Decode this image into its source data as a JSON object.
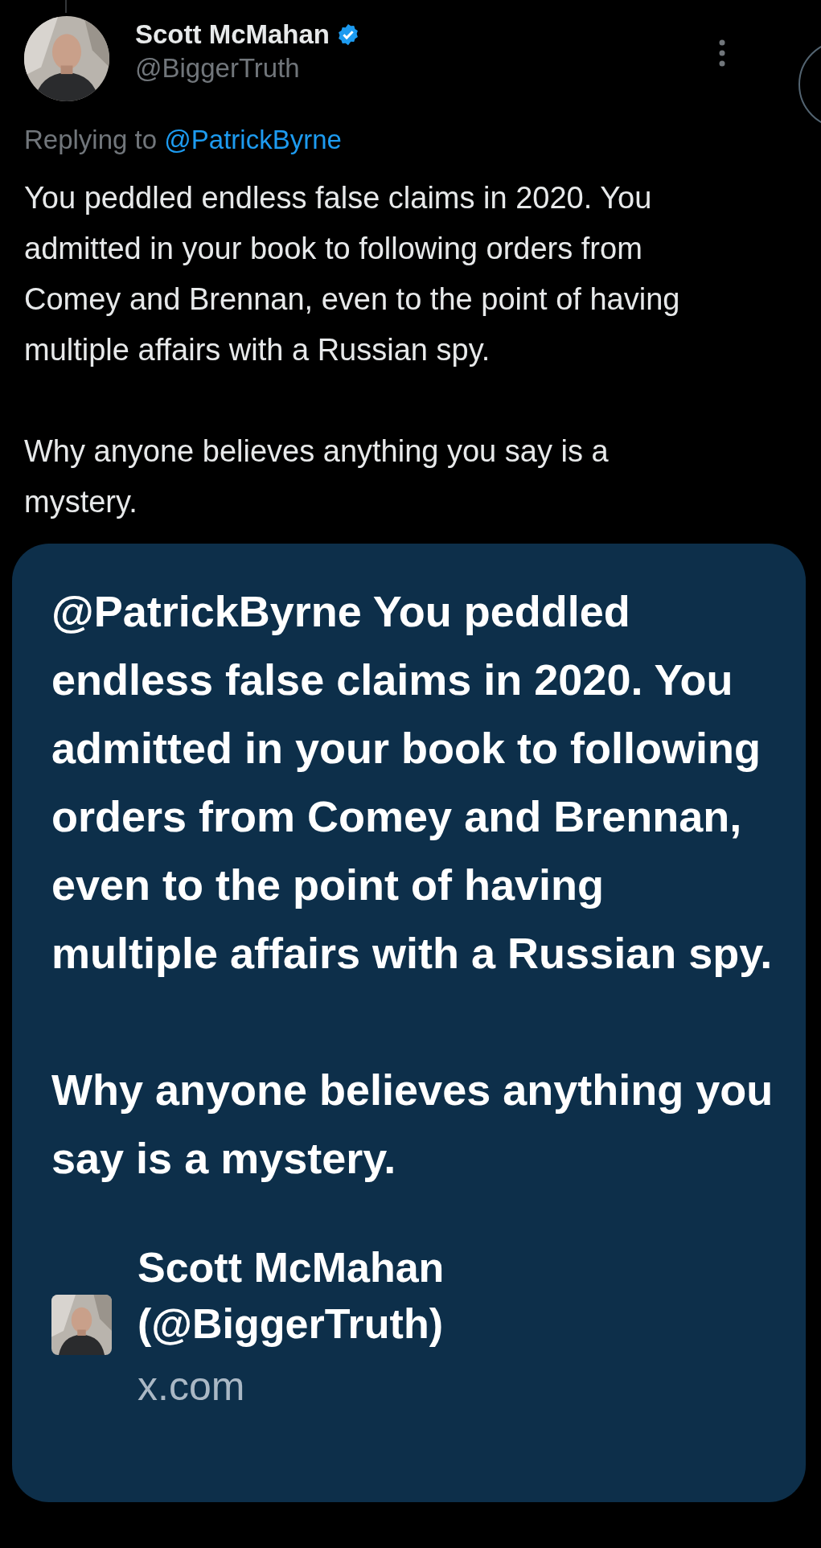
{
  "tweet": {
    "author": {
      "name": "Scott McMahan",
      "verified": true,
      "handle": "@BiggerTruth"
    },
    "reply_prefix": "Replying to",
    "reply_to": "@PatrickByrne",
    "text": "You peddled endless false claims in 2020. You admitted in your book to following orders from Comey and Brennan, even to the point of having multiple affairs with a Russian spy.\n\nWhy anyone believes anything you say is a mystery."
  },
  "message": {
    "text": "@PatrickByrne You peddled endless false claims in 2020. You admitted in your book to following orders from Comey and Brennan, even to the point of having multiple affairs with a Russian spy.\n\nWhy anyone believes anything you say is a mystery.",
    "link_preview": {
      "title": "Scott McMahan (@BiggerTruth)",
      "domain": "x.com"
    }
  }
}
